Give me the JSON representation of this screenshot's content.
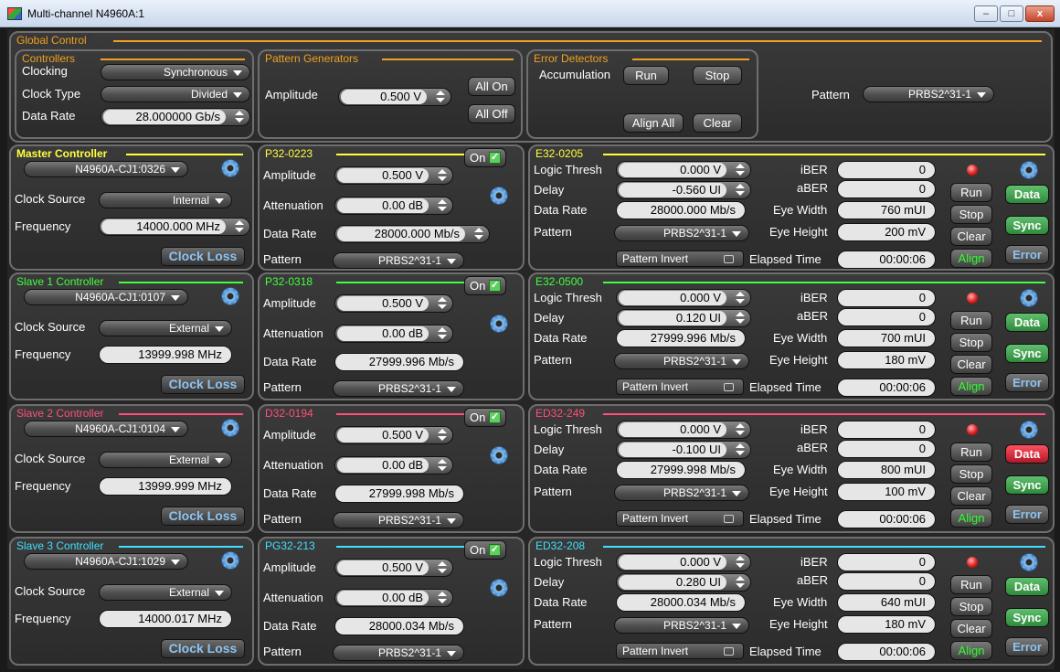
{
  "window": {
    "title": "Multi-channel N4960A:1",
    "min": "–",
    "max": "□",
    "close": "x"
  },
  "global": {
    "title": "Global Control",
    "controllers": {
      "title": "Controllers",
      "clocking_label": "Clocking",
      "clocking": "Synchronous",
      "clock_type_label": "Clock Type",
      "clock_type": "Divided",
      "data_rate_label": "Data Rate",
      "data_rate": "28.000000 Gb/s"
    },
    "pg": {
      "title": "Pattern Generators",
      "amplitude_label": "Amplitude",
      "amplitude": "0.500 V",
      "all_on": "All On",
      "all_off": "All Off"
    },
    "ed": {
      "title": "Error Detectors",
      "accumulation_label": "Accumulation",
      "run": "Run",
      "stop": "Stop",
      "align_all": "Align All",
      "clear": "Clear"
    },
    "pattern_label": "Pattern",
    "pattern": "PRBS2^31-1"
  },
  "rows": [
    {
      "ctrl": {
        "title": "Master Controller",
        "color": "#ffff40",
        "device": "N4960A-CJ1:0326",
        "clock_source": "Internal",
        "frequency": "14000.000 MHz",
        "freq_spin": true
      },
      "gen": {
        "title": "P32-0223",
        "amplitude": "0.500 V",
        "attenuation": "0.00 dB",
        "data_rate": "28000.000 Mb/s",
        "rate_spin": true,
        "pattern": "PRBS2^31-1"
      },
      "det": {
        "title": "E32-0205",
        "logic_thresh": "0.000 V",
        "delay": "-0.560 UI",
        "data_rate": "28000.000 Mb/s",
        "pattern": "PRBS2^31-1",
        "ibér": "0",
        "iber": "0",
        "aber": "0",
        "eye_width": "760 mUI",
        "eye_height": "200 mV",
        "elapsed": "00:00:06",
        "data_red": false
      }
    },
    {
      "ctrl": {
        "title": "Slave 1 Controller",
        "color": "#40ff40",
        "device": "N4960A-CJ1:0107",
        "clock_source": "External",
        "frequency": "13999.998 MHz",
        "freq_spin": false
      },
      "gen": {
        "title": "P32-0318",
        "amplitude": "0.500 V",
        "attenuation": "0.00 dB",
        "data_rate": "27999.996 Mb/s",
        "rate_spin": false,
        "pattern": "PRBS2^31-1"
      },
      "det": {
        "title": "E32-0500",
        "logic_thresh": "0.000 V",
        "delay": "0.120 UI",
        "data_rate": "27999.996 Mb/s",
        "pattern": "PRBS2^31-1",
        "iber": "0",
        "aber": "0",
        "eye_width": "700 mUI",
        "eye_height": "180 mV",
        "elapsed": "00:00:06",
        "data_red": false
      }
    },
    {
      "ctrl": {
        "title": "Slave 2 Controller",
        "color": "#ff4f7a",
        "device": "N4960A-CJ1:0104",
        "clock_source": "External",
        "frequency": "13999.999 MHz",
        "freq_spin": false
      },
      "gen": {
        "title": "D32-0194",
        "amplitude": "0.500 V",
        "attenuation": "0.00 dB",
        "data_rate": "27999.998 Mb/s",
        "rate_spin": false,
        "pattern": "PRBS2^31-1"
      },
      "det": {
        "title": "ED32-249",
        "logic_thresh": "0.000 V",
        "delay": "-0.100 UI",
        "data_rate": "27999.998 Mb/s",
        "pattern": "PRBS2^31-1",
        "iber": "0",
        "aber": "0",
        "eye_width": "800 mUI",
        "eye_height": "100 mV",
        "elapsed": "00:00:06",
        "data_red": true
      }
    },
    {
      "ctrl": {
        "title": "Slave 3 Controller",
        "color": "#40e0ff",
        "device": "N4960A-CJ1:1029",
        "clock_source": "External",
        "frequency": "14000.017 MHz",
        "freq_spin": false
      },
      "gen": {
        "title": "PG32-213",
        "amplitude": "0.500 V",
        "attenuation": "0.00 dB",
        "data_rate": "28000.034 Mb/s",
        "rate_spin": false,
        "pattern": "PRBS2^31-1"
      },
      "det": {
        "title": "ED32-208",
        "logic_thresh": "0.000 V",
        "delay": "0.280 UI",
        "data_rate": "28000.034 Mb/s",
        "pattern": "PRBS2^31-1",
        "iber": "0",
        "aber": "0",
        "eye_width": "640 mUI",
        "eye_height": "180 mV",
        "elapsed": "00:00:06",
        "data_red": false
      }
    }
  ],
  "labels": {
    "clock_source": "Clock Source",
    "frequency": "Frequency",
    "clock_loss": "Clock Loss",
    "on": "On",
    "amplitude": "Amplitude",
    "attenuation": "Attenuation",
    "data_rate": "Data Rate",
    "pattern": "Pattern",
    "logic_thresh": "Logic Thresh",
    "delay": "Delay",
    "pattern_invert": "Pattern Invert",
    "elapsed": "Elapsed Time",
    "iber": "iBER",
    "aber": "aBER",
    "eye_width": "Eye Width",
    "eye_height": "Eye Height",
    "run": "Run",
    "stop": "Stop",
    "clear": "Clear",
    "align": "Align",
    "data": "Data",
    "sync": "Sync",
    "error": "Error"
  },
  "colors": {
    "global_accent": "#f0a020",
    "check_green": "#5fcf5f",
    "align_green": "#30ff30",
    "data_green": "#2e8a3a",
    "data_red": "#d02030",
    "error_text": "#8fc3f0"
  }
}
